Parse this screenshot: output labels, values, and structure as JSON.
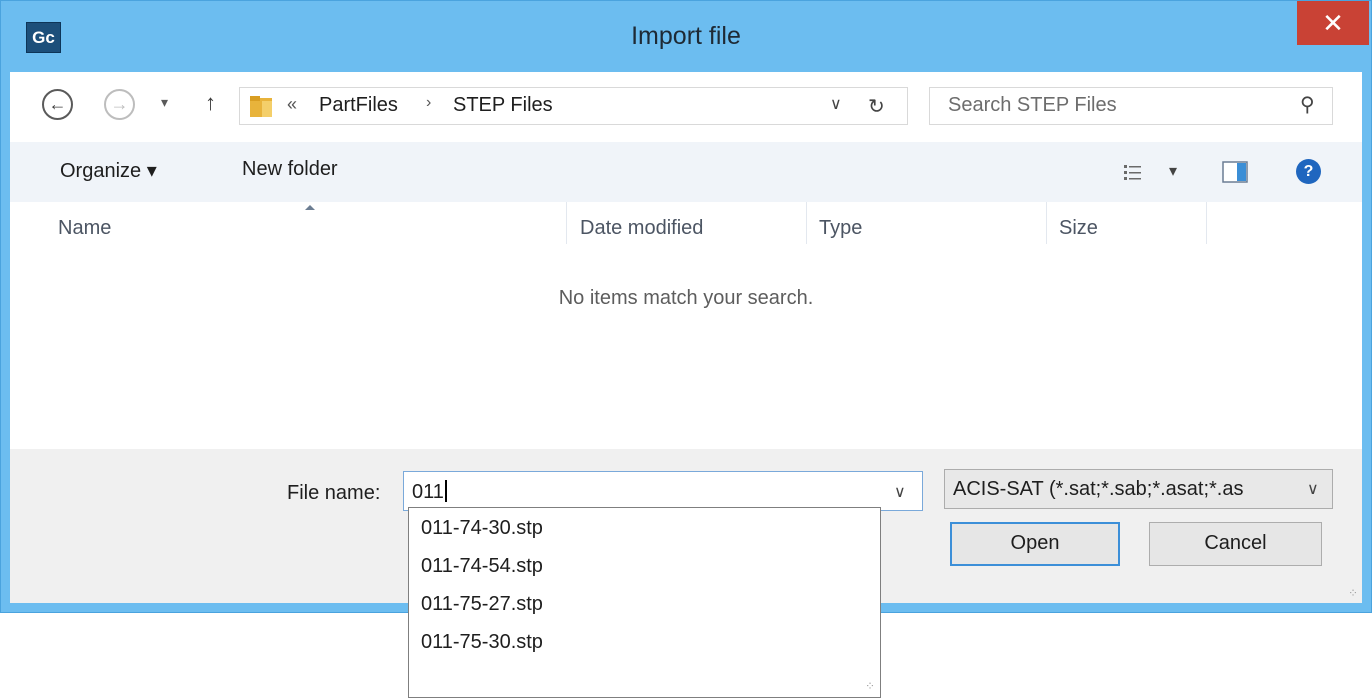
{
  "window": {
    "app_icon_text": "Gc",
    "title": "Import file",
    "close_glyph": "✕"
  },
  "nav": {
    "back_glyph": "←",
    "forward_glyph": "→",
    "recent_glyph": "▾",
    "up_glyph": "↑",
    "breadcrumb_overflow": "«",
    "breadcrumb": [
      "PartFiles",
      "STEP Files"
    ],
    "breadcrumb_sep": "›",
    "dropdown_glyph": "∨",
    "refresh_glyph": "↻",
    "search_placeholder": "Search STEP Files",
    "search_glyph": "⚲"
  },
  "toolbar": {
    "organize_label": "Organize ▾",
    "new_folder_label": "New folder",
    "view_menu_glyph": "▾",
    "help_glyph": "?"
  },
  "columns": [
    "Name",
    "Date modified",
    "Type",
    "Size"
  ],
  "empty_message": "No items match your search.",
  "file_name": {
    "label": "File name:",
    "value": "011",
    "dropdown_glyph": "∨"
  },
  "file_type": {
    "selected": "ACIS-SAT (*.sat;*.sab;*.asat;*.as",
    "dropdown_glyph": "∨"
  },
  "buttons": {
    "open": "Open",
    "cancel": "Cancel"
  },
  "suggestions": [
    "011-74-30.stp",
    "011-74-54.stp",
    "011-75-27.stp",
    "011-75-30.stp"
  ],
  "colors": {
    "titlebar": "#6cbdf0",
    "close_button": "#c94235",
    "accent": "#3c8fd8"
  }
}
